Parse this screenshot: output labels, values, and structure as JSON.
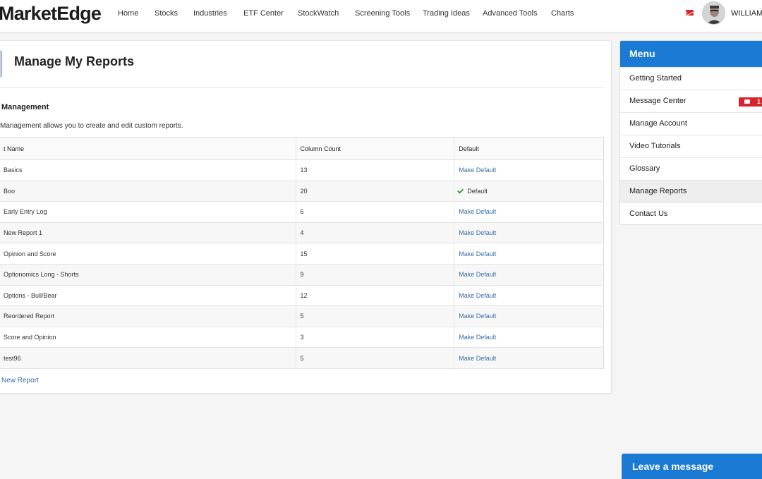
{
  "brand": {
    "logo_text": "MarketEdge"
  },
  "nav": {
    "items": [
      "Home",
      "Stocks",
      "Industries",
      "ETF Center",
      "StockWatch",
      "Screening Tools",
      "Trading Ideas",
      "Advanced Tools",
      "Charts"
    ],
    "user_name": "WILLIAM"
  },
  "page": {
    "title": "Manage My Reports",
    "section_heading": "Management",
    "section_desc": "Management allows you to create and edit custom reports.",
    "new_report_link": "New Report"
  },
  "table": {
    "headers": {
      "name": "t Name",
      "count": "Column Count",
      "default": "Default"
    },
    "rows": [
      {
        "name": "Basics",
        "count": "13",
        "default": "Make Default"
      },
      {
        "name": "Boo",
        "count": "20",
        "default": "Default",
        "is_default": true
      },
      {
        "name": "Early Entry Log",
        "count": "6",
        "default": "Make Default"
      },
      {
        "name": "New Report 1",
        "count": "4",
        "default": "Make Default"
      },
      {
        "name": "Opinion and Score",
        "count": "15",
        "default": "Make Default"
      },
      {
        "name": "Optionomics Long - Shorts",
        "count": "9",
        "default": "Make Default"
      },
      {
        "name": "Options - Bull/Bear",
        "count": "12",
        "default": "Make Default"
      },
      {
        "name": "Reordered Report",
        "count": "5",
        "default": "Make Default"
      },
      {
        "name": "Score and Opinion",
        "count": "3",
        "default": "Make Default"
      },
      {
        "name": "test96",
        "count": "5",
        "default": "Make Default"
      }
    ]
  },
  "side_menu": {
    "header": "Menu",
    "items": [
      {
        "label": "Getting Started"
      },
      {
        "label": "Message Center",
        "badge": "1"
      },
      {
        "label": "Manage Account"
      },
      {
        "label": "Video Tutorials"
      },
      {
        "label": "Glossary"
      },
      {
        "label": "Manage Reports",
        "active": true
      },
      {
        "label": "Contact Us"
      }
    ]
  },
  "chat": {
    "label": "Leave a message"
  },
  "icons": {
    "mail": "mail-icon",
    "avatar": "avatar-icon",
    "check": "check-icon"
  },
  "colors": {
    "accent_blue": "#1a7ad4",
    "link_blue": "#3a6ea5",
    "alert_red": "#d9232d",
    "check_green": "#3aa23a"
  }
}
